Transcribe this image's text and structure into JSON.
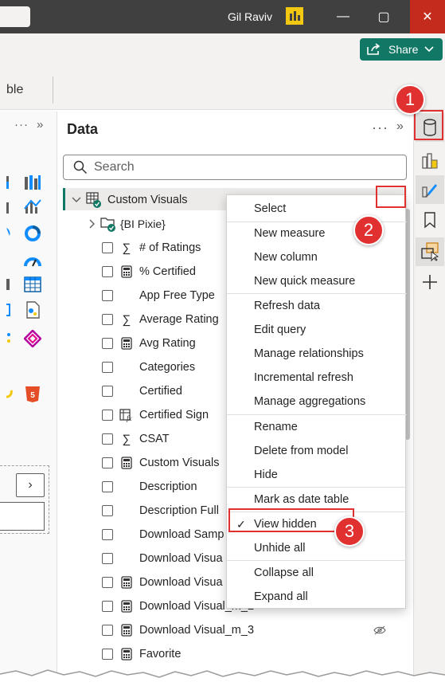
{
  "titlebar": {
    "user_name": "Gil Raviv",
    "minimize": "—",
    "maximize": "▢",
    "close": "✕"
  },
  "ribbon": {
    "share_label": "Share",
    "partial_text": "ble"
  },
  "left_panel": {
    "more": "···",
    "collapse": "»",
    "nav_next": "›"
  },
  "data_panel": {
    "title": "Data",
    "more": "···",
    "collapse": "»",
    "search_placeholder": "Search",
    "root": "Custom Visuals",
    "folder": "{BI Pixie}",
    "fields": [
      {
        "label": "# of Ratings",
        "type": "sum"
      },
      {
        "label": "% Certified",
        "type": "calc"
      },
      {
        "label": "App Free Type",
        "type": "none"
      },
      {
        "label": "Average Rating",
        "type": "sum"
      },
      {
        "label": "Avg Rating",
        "type": "calc"
      },
      {
        "label": "Categories",
        "type": "none"
      },
      {
        "label": "Certified",
        "type": "none"
      },
      {
        "label": "Certified Sign",
        "type": "fx"
      },
      {
        "label": "CSAT",
        "type": "sum"
      },
      {
        "label": "Custom Visuals",
        "type": "calc"
      },
      {
        "label": "Description",
        "type": "none"
      },
      {
        "label": "Description Full",
        "type": "none"
      },
      {
        "label": "Download Samp",
        "type": "none"
      },
      {
        "label": "Download Visua",
        "type": "none"
      },
      {
        "label": "Download Visua",
        "type": "calc"
      },
      {
        "label": "Download Visual_m_2",
        "type": "calc"
      },
      {
        "label": "Download Visual_m_3",
        "type": "calc"
      },
      {
        "label": "Favorite",
        "type": "calc"
      }
    ]
  },
  "context_menu": {
    "items": [
      "Select",
      "New measure",
      "New column",
      "New quick measure",
      "Refresh data",
      "Edit query",
      "Manage relationships",
      "Incremental refresh",
      "Manage aggregations",
      "Rename",
      "Delete from model",
      "Hide",
      "Mark as date table",
      "View hidden",
      "Unhide all",
      "Collapse all",
      "Expand all"
    ],
    "checked_item": "View hidden"
  },
  "annotations": {
    "badge_1": "1",
    "badge_2": "2",
    "badge_3": "3"
  },
  "colors": {
    "accent": "#117865",
    "annotation_red": "#e03030",
    "titlebar": "#404040",
    "close": "#c42b1c"
  }
}
